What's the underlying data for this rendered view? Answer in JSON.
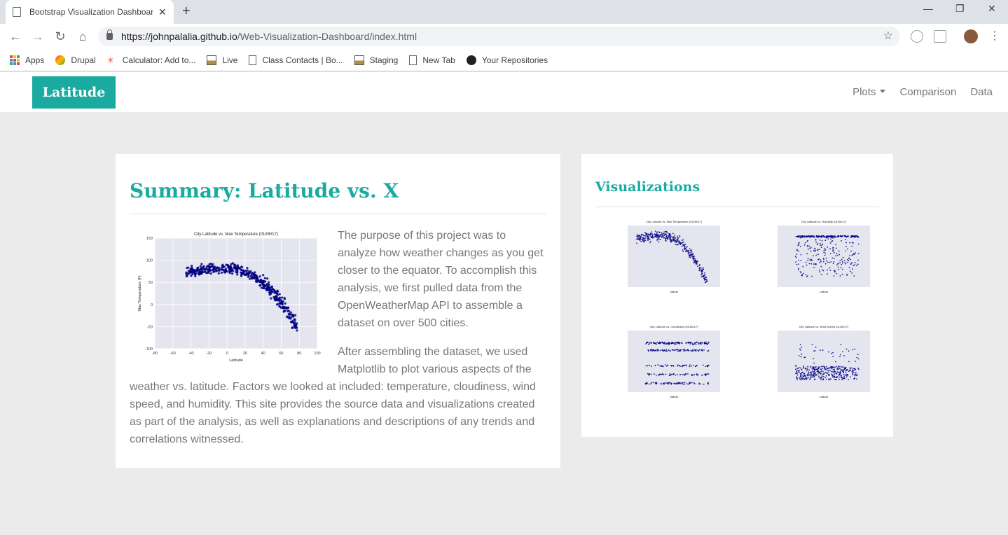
{
  "browser": {
    "tab_title": "Bootstrap Visualization Dashboard",
    "url_host": "https://johnpalalia.github.io",
    "url_path": "/Web-Visualization-Dashboard/index.html",
    "bookmarks": [
      {
        "label": "Apps",
        "icon": "apps-grid-icon"
      },
      {
        "label": "Drupal",
        "icon": "drupal-icon"
      },
      {
        "label": "Calculator: Add to...",
        "icon": "calculator-icon"
      },
      {
        "label": "Live",
        "icon": "image-icon"
      },
      {
        "label": "Class Contacts | Bo...",
        "icon": "page-icon"
      },
      {
        "label": "Staging",
        "icon": "image-icon"
      },
      {
        "label": "New Tab",
        "icon": "page-icon"
      },
      {
        "label": "Your Repositories",
        "icon": "github-icon"
      }
    ]
  },
  "navbar": {
    "brand": "Latitude",
    "links": [
      "Plots",
      "Comparison",
      "Data"
    ]
  },
  "summary": {
    "title": "Summary: Latitude vs. X",
    "paragraph1": "The purpose of this project was to analyze how weather changes as you get closer to the equator. To accomplish this analysis, we first pulled data from the OpenWeatherMap API to assemble a dataset on over 500 cities.",
    "paragraph2": "After assembling the dataset, we used Matplotlib to plot various aspects of the weather vs. latitude. Factors we looked at included: temperature, cloudiness, wind speed, and humidity. This site provides the source data and visualizations created as part of the analysis, as well as explanations and descriptions of any trends and correlations witnessed."
  },
  "visualizations": {
    "title": "Visualizations"
  },
  "chart_data": [
    {
      "type": "scatter",
      "title": "City Latitude vs. Max Temperature (01/06/17)",
      "xlabel": "Latitude",
      "ylabel": "Max Temperature (F)",
      "xlim": [
        -80,
        100
      ],
      "ylim": [
        -100,
        150
      ],
      "xticks": [
        -80,
        -60,
        -40,
        -20,
        0,
        20,
        40,
        60,
        80,
        100
      ],
      "yticks": [
        -100,
        -50,
        0,
        50,
        100,
        150
      ],
      "grid": true,
      "color": "#000080",
      "background": "#e5e5f0",
      "trend": "temperature peaks near latitude -20 to 10 (~75-85 F) and falls to about -50 F near latitude 75"
    },
    {
      "type": "scatter",
      "title": "City Latitude vs. Max Temperature (01/06/17)",
      "xlabel": "Latitude",
      "xlim": [
        -60,
        100
      ],
      "ylim": [
        -60,
        100
      ]
    },
    {
      "type": "scatter",
      "title": "City Latitude vs. Humidity (01/06/17)",
      "xlabel": "Latitude",
      "xlim": [
        -80,
        100
      ],
      "ylim": [
        0,
        120
      ]
    },
    {
      "type": "scatter",
      "title": "City Latitude vs. Cloudiness (01/06/17)",
      "xlabel": "Latitude",
      "xlim": [
        -80,
        100
      ],
      "ylim": [
        -20,
        120
      ]
    },
    {
      "type": "scatter",
      "title": "City Latitude vs. Wind Speed (01/06/17)",
      "xlabel": "Latitude",
      "xlim": [
        -80,
        100
      ],
      "ylim": [
        -5,
        40
      ]
    }
  ]
}
